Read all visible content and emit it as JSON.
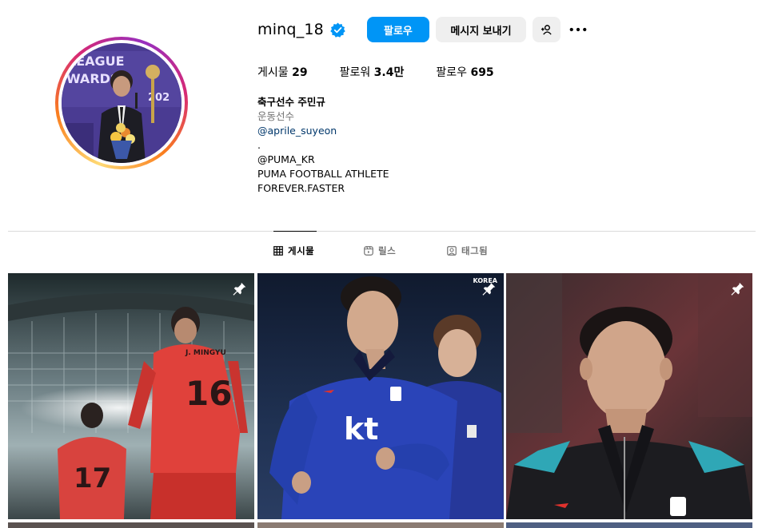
{
  "profile": {
    "username": "minq_18",
    "verified": true,
    "follow_label": "팔로우",
    "message_label": "메시지 보내기",
    "suggest_icon": "add-person-icon",
    "more_icon": "more-horizontal-icon"
  },
  "stats": {
    "posts_label": "게시물",
    "posts_count": "29",
    "followers_label": "팔로워",
    "followers_count": "3.4만",
    "following_label": "팔로우",
    "following_count": "695"
  },
  "bio": {
    "name": "축구선수 주민규",
    "category": "운동선수",
    "threads_handle": "@aprile_suyeon",
    "line_dot": ".",
    "line_puma": "@PUMA_KR",
    "line_athlete": "PUMA FOOTBALL ATHLETE",
    "line_forever": "FOREVER.FASTER"
  },
  "tabs": [
    {
      "label": "게시물",
      "icon": "grid-icon",
      "active": true
    },
    {
      "label": "릴스",
      "icon": "reels-icon",
      "active": false
    },
    {
      "label": "태그됨",
      "icon": "tagged-icon",
      "active": false
    }
  ],
  "posts": [
    {
      "pinned": true,
      "jersey_left": "17",
      "jersey_right": "16",
      "name_right": "J. MINGYU"
    },
    {
      "pinned": true,
      "brand": "kt",
      "badge": "KOREA"
    },
    {
      "pinned": true
    }
  ],
  "colors": {
    "accent": "#0095f6",
    "secondary_button": "#efefef",
    "muted_text": "#737373",
    "link_text": "#00376b",
    "divider": "#dbdbdb",
    "verified": "#0095f6"
  }
}
